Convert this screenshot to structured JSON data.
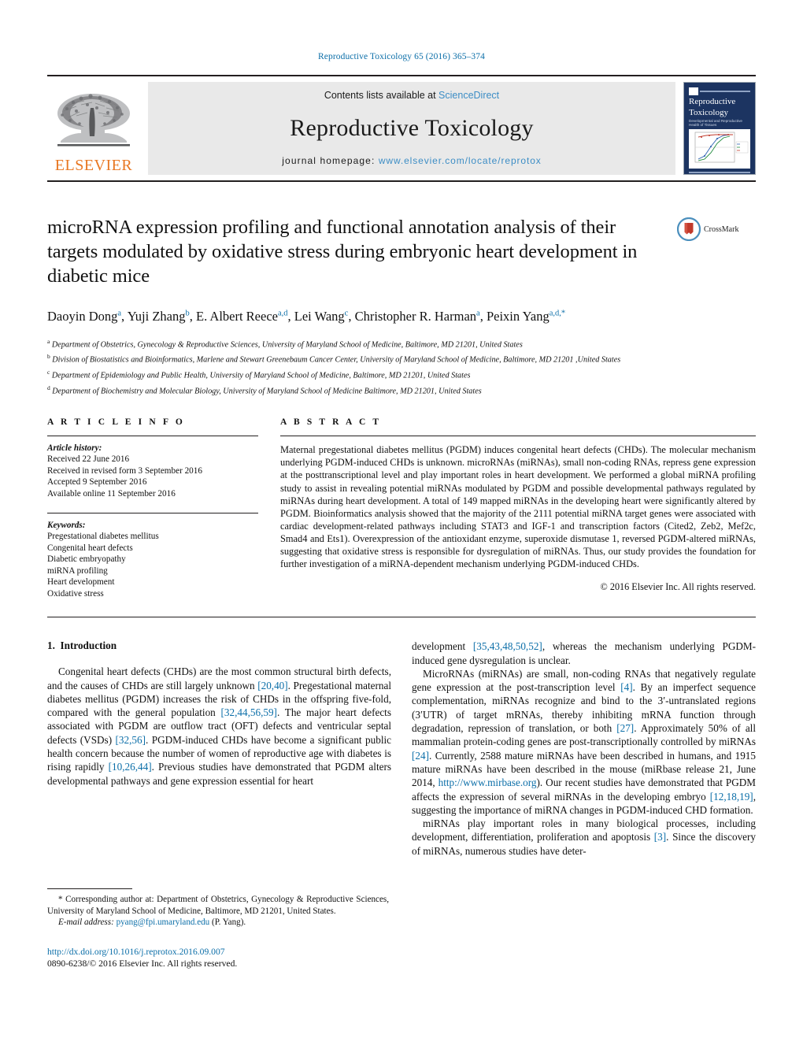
{
  "running_head": "Reproductive Toxicology 65 (2016) 365–374",
  "masthead": {
    "publisher_logo_text": "ELSEVIER",
    "contents_prefix": "Contents lists available at ",
    "contents_link": "ScienceDirect",
    "journal_name": "Reproductive Toxicology",
    "homepage_prefix": "journal homepage: ",
    "homepage_link": "www.elsevier.com/locate/reprotox",
    "cover": {
      "title_line1": "Reproductive",
      "title_line2": "Toxicology",
      "subtitle": "Developmental and Reproductive Health of Tissues"
    }
  },
  "article": {
    "title": "microRNA expression profiling and functional annotation analysis of their targets modulated by oxidative stress during embryonic heart development in diabetic mice",
    "crossmark_label": "CrossMark",
    "authors": [
      {
        "name": "Daoyin Dong",
        "sup": "a",
        "sep": ", "
      },
      {
        "name": "Yuji Zhang",
        "sup": "b",
        "sep": ", "
      },
      {
        "name": "E. Albert Reece",
        "sup": "a,d",
        "sep": ", "
      },
      {
        "name": "Lei Wang",
        "sup": "c",
        "sep": ", "
      },
      {
        "name": "Christopher R. Harman",
        "sup": "a",
        "sep": ", "
      },
      {
        "name": "Peixin Yang",
        "sup": "a,d,",
        "sup_star": "*",
        "sep": ""
      }
    ],
    "affiliations": [
      {
        "marker": "a",
        "text": "Department of Obstetrics, Gynecology & Reproductive Sciences, University of Maryland School of Medicine, Baltimore, MD 21201, United States"
      },
      {
        "marker": "b",
        "text": "Division of Biostatistics and Bioinformatics, Marlene and Stewart Greenebaum Cancer Center, University of Maryland School of Medicine, Baltimore, MD 21201 ,United States"
      },
      {
        "marker": "c",
        "text": "Department of Epidemiology and Public Health, University of Maryland School of Medicine, Baltimore, MD 21201, United States"
      },
      {
        "marker": "d",
        "text": "Department of Biochemistry and Molecular Biology, University of Maryland School of Medicine Baltimore, MD 21201, United States"
      }
    ]
  },
  "article_info": {
    "heading": "A R T I C L E   I N F O",
    "history_label": "Article history:",
    "history": [
      "Received 22 June 2016",
      "Received in revised form 3 September 2016",
      "Accepted 9 September 2016",
      "Available online 11 September 2016"
    ],
    "keywords_label": "Keywords:",
    "keywords": [
      "Pregestational diabetes mellitus",
      "Congenital heart defects",
      "Diabetic embryopathy",
      "miRNA profiling",
      "Heart development",
      "Oxidative stress"
    ]
  },
  "abstract": {
    "heading": "A B S T R A C T",
    "text": "Maternal pregestational diabetes mellitus (PGDM) induces congenital heart defects (CHDs). The molecular mechanism underlying PGDM-induced CHDs is unknown. microRNAs (miRNAs), small non-coding RNAs, repress gene expression at the posttranscriptional level and play important roles in heart development. We performed a global miRNA profiling study to assist in revealing potential miRNAs modulated by PGDM and possible developmental pathways regulated by miRNAs during heart development. A total of 149 mapped miRNAs in the developing heart were significantly altered by PGDM. Bioinformatics analysis showed that the majority of the 2111 potential miRNA target genes were associated with cardiac development-related pathways including STAT3 and IGF-1 and transcription factors (Cited2, Zeb2, Mef2c, Smad4 and Ets1). Overexpression of the antioxidant enzyme, superoxide dismutase 1, reversed PGDM-altered miRNAs, suggesting that oxidative stress is responsible for dysregulation of miRNAs. Thus, our study provides the foundation for further investigation of a miRNA-dependent mechanism underlying PGDM-induced CHDs.",
    "copyright": "© 2016 Elsevier Inc. All rights reserved."
  },
  "introduction": {
    "section_number": "1.",
    "section_title": "Introduction",
    "left_paragraphs": [
      "Congenital heart defects (CHDs) are the most common structural birth defects, and the causes of CHDs are still largely unknown [20,40]. Pregestational maternal diabetes mellitus (PGDM) increases the risk of CHDs in the offspring five-fold, compared with the general population [32,44,56,59]. The major heart defects associated with PGDM are outflow tract (OFT) defects and ventricular septal defects (VSDs) [32,56]. PGDM-induced CHDs have become a significant public health concern because the number of women of reproductive age with diabetes is rising rapidly [10,26,44]. Previous studies have demonstrated that PGDM alters developmental pathways and gene expression essential for heart"
    ],
    "right_paragraphs": [
      "development [35,43,48,50,52], whereas the mechanism underlying PGDM-induced gene dysregulation is unclear.",
      "MicroRNAs (miRNAs) are small, non-coding RNAs that negatively regulate gene expression at the post-transcription level [4]. By an imperfect sequence complementation, miRNAs recognize and bind to the 3′-untranslated regions (3′UTR) of target mRNAs, thereby inhibiting mRNA function through degradation, repression of translation, or both [27]. Approximately 50% of all mammalian protein-coding genes are post-transcriptionally controlled by miRNAs [24]. Currently, 2588 mature miRNAs have been described in humans, and 1915 mature miRNAs have been described in the mouse (miRbase release 21, June 2014, http://www.mirbase.org). Our recent studies have demonstrated that PGDM affects the expression of several miRNAs in the developing embryo [12,18,19], suggesting the importance of miRNA changes in PGDM-induced CHD formation.",
      "miRNAs play important roles in many biological processes, including development, differentiation, proliferation and apoptosis [3]. Since the discovery of miRNAs, numerous studies have deter-"
    ]
  },
  "footnote": {
    "star": "*",
    "corresponding": "Corresponding author at: Department of Obstetrics, Gynecology & Reproductive Sciences, University of Maryland School of Medicine, Baltimore, MD 21201, United States.",
    "email_label": "E-mail address:",
    "email": "pyang@fpi.umaryland.edu",
    "email_suffix": "(P. Yang).",
    "doi": "http://dx.doi.org/10.1016/j.reprotox.2016.09.007",
    "issn": "0890-6238/© 2016 Elsevier Inc. All rights reserved."
  },
  "colors": {
    "link": "#0b6ea8",
    "masthead_link": "#3c8dc5",
    "elsevier_orange": "#e87722",
    "masthead_band": "#e9e9e9",
    "cover_navy": "#1c3461"
  }
}
